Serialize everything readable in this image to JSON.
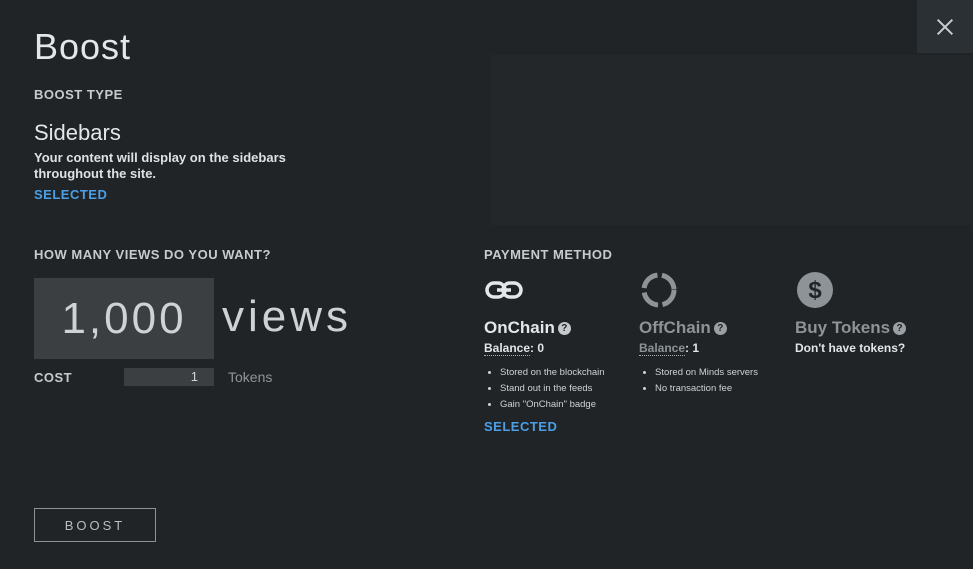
{
  "modal": {
    "title": "Boost",
    "close_icon": "close-icon"
  },
  "boost_type": {
    "heading": "BOOST TYPE",
    "name": "Sidebars",
    "description": "Your content will display on the sidebars throughout the site.",
    "status": "SELECTED"
  },
  "views": {
    "heading": "HOW MANY VIEWS DO YOU WANT?",
    "value": "1,000",
    "unit_label": "views"
  },
  "cost": {
    "label": "COST",
    "value": "1",
    "unit": "Tokens"
  },
  "payment": {
    "heading": "PAYMENT METHOD",
    "methods": [
      {
        "icon": "link-icon",
        "name": "OnChain",
        "balance_label": "Balance",
        "balance_value": ": 0",
        "features": [
          "Stored on the blockchain",
          "Stand out in the feeds",
          "Gain \"OnChain\" badge"
        ],
        "status": "SELECTED",
        "color": "#e4e6e8"
      },
      {
        "icon": "ring-spinner-icon",
        "name": "OffChain",
        "balance_label": "Balance",
        "balance_value": ": 1",
        "features": [
          "Stored on Minds servers",
          "No transaction fee"
        ],
        "color": "#8e9397"
      },
      {
        "icon": "dollar-coin-icon",
        "name": "Buy Tokens",
        "subtitle": "Don't have tokens?",
        "color": "#8e9397"
      }
    ]
  },
  "actions": {
    "boost_label": "BOOST"
  }
}
